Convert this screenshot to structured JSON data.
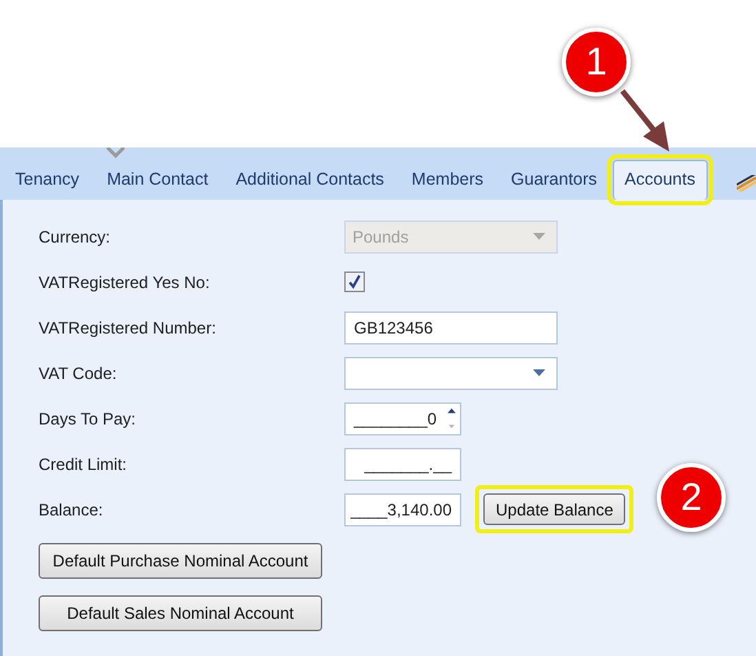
{
  "tabs": [
    {
      "label": "Tenancy",
      "selected": false,
      "highlighted": false
    },
    {
      "label": "Main Contact",
      "selected": false,
      "highlighted": false
    },
    {
      "label": "Additional Contacts",
      "selected": false,
      "highlighted": false
    },
    {
      "label": "Members",
      "selected": false,
      "highlighted": false
    },
    {
      "label": "Guarantors",
      "selected": false,
      "highlighted": false
    },
    {
      "label": "Accounts",
      "selected": true,
      "highlighted": true
    }
  ],
  "fields": [
    {
      "kind": "dropdown",
      "label": "Currency:",
      "value": "Pounds",
      "disabled": true
    },
    {
      "kind": "checkbox",
      "label": "VATRegistered Yes No:",
      "checked": true
    },
    {
      "kind": "text",
      "label": "VATRegistered Number:",
      "value": "GB123456"
    },
    {
      "kind": "dropdown",
      "label": "VAT Code:",
      "disabled": false
    },
    {
      "kind": "spinner",
      "label": "Days To Pay:",
      "value": "________0"
    },
    {
      "kind": "masked",
      "label": "Credit Limit:",
      "value": "_______.__"
    },
    {
      "kind": "masked",
      "label": "Balance:",
      "value": "____3,140.00",
      "button": {
        "label": "Update Balance",
        "highlighted": true
      }
    }
  ],
  "buttons": [
    {
      "label": "Default Purchase Nominal Account"
    },
    {
      "label": "Default Sales Nominal Account"
    }
  ],
  "callouts": [
    {
      "number": "1"
    },
    {
      "number": "2"
    }
  ]
}
